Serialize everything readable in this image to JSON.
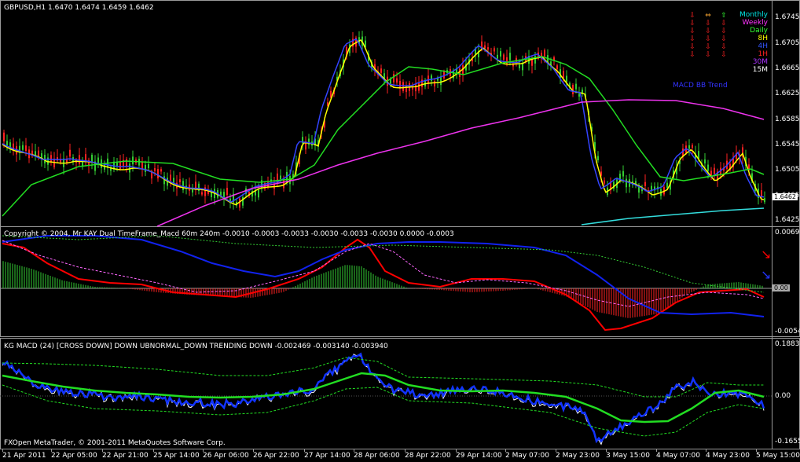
{
  "main": {
    "title": "GBPUSD,H1  1.6470 1.6474 1.6459 1.6462",
    "price_tag": "1.6462",
    "yticks": [
      "1.6745",
      "1.6705",
      "1.6665",
      "1.6625",
      "1.6585",
      "1.6545",
      "1.6505",
      "1.6465",
      "1.6425"
    ],
    "timeframes": [
      {
        "label": "Monthly",
        "color": "#00e5e5"
      },
      {
        "label": "Weekly",
        "color": "#ff33ff"
      },
      {
        "label": "Daily",
        "color": "#33ff33"
      },
      {
        "label": "8H",
        "color": "#ffff00"
      },
      {
        "label": "4H",
        "color": "#3355ff"
      },
      {
        "label": "1H",
        "color": "#ff2222"
      },
      {
        "label": "30M",
        "color": "#aa33ff"
      },
      {
        "label": "15M",
        "color": "#ffffff"
      }
    ],
    "macd_label": "MACD  BB  Trend",
    "macd_label_color": "#3333ff",
    "colors": {
      "up": "#33cc33",
      "down": "#ff2222",
      "fast": "#ffff00",
      "mid": "#3344ff",
      "slow": "#22dd22",
      "long": "#ee33ee",
      "monthly": "#33dddd"
    }
  },
  "macd1": {
    "title": "Copyright © 2004, Mr KAY Dual TimeFrame_Macd 60m 240m  -0.0010 -0.0003 -0.0033 -0.0030 -0.0033 -0.0030 0.0000 -0.0003",
    "yticks": [
      "0.0069",
      "0.00",
      "-0.0054"
    ],
    "colors": {
      "hist_up": "#33cc33",
      "hist_down": "#ff2222",
      "red": "#ff0000",
      "blue": "#1122ee",
      "signal": "#ff66ff",
      "dotted": "#33cc33"
    }
  },
  "macd2": {
    "title": "KG MACD (24)  [CROSS DOWN]  DOWN  UBNORMAL_DOWN  TRENDING DOWN  -0.002469 -0.003140 -0.003940",
    "yticks": [
      "0.18836",
      "0.00",
      "-0.16551"
    ],
    "colors": {
      "blue": "#1133ff",
      "white": "#ffffff",
      "green": "#22dd22",
      "dash": "#22dd22"
    }
  },
  "footer": "FXOpen MetaTrader, © 2001-2011 MetaQuotes Software Corp.",
  "xlabels": [
    "21 Apr 2011",
    "22 Apr 05:00",
    "22 Apr 21:00",
    "25 Apr 14:00",
    "26 Apr 06:00",
    "26 Apr 22:00",
    "27 Apr 14:00",
    "28 Apr 06:00",
    "28 Apr 22:00",
    "29 Apr 14:00",
    "2 May 07:00",
    "2 May 23:00",
    "3 May 15:00",
    "4 May 07:00",
    "4 May 23:00",
    "5 May 15:00"
  ]
}
